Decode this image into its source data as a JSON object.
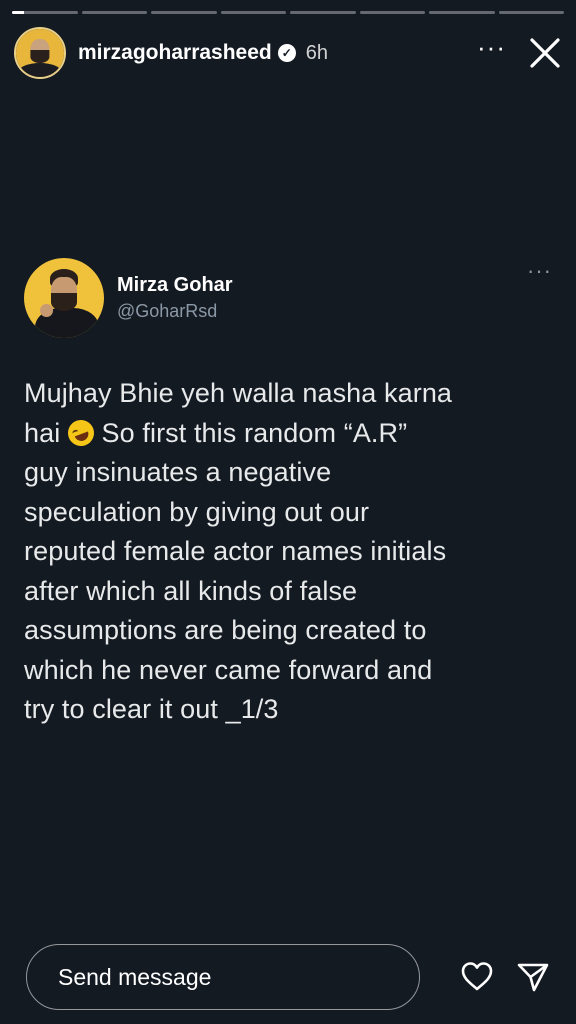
{
  "story": {
    "progress": {
      "segments": 8,
      "active_index": 0,
      "active_fill": 0.18
    },
    "header": {
      "username": "mirzagoharrasheed",
      "verified_icon": "verified-badge-icon",
      "time": "6h",
      "more_icon": "more-horizontal-icon",
      "close_icon": "close-icon"
    }
  },
  "tweet": {
    "display_name": "Mirza Gohar",
    "handle": "@GoharRsd",
    "more_icon": "more-horizontal-icon",
    "text_before_emoji": "Mujhay Bhie yeh walla nasha karna\nhai ",
    "emoji": "rolling-on-floor-laughing-emoji",
    "text_after_emoji": " So first this random “A.R”\nguy insinuates a negative\nspeculation by giving out our\nreputed female actor names initials\nafter which all kinds of false\nassumptions are being created to\nwhich he never came forward and\ntry to clear it out _1/3"
  },
  "footer": {
    "message_placeholder": "Send message",
    "heart_icon": "heart-icon",
    "share_icon": "send-icon"
  },
  "colors": {
    "background": "#141a22",
    "text": "#ffffff",
    "handle": "#8b98a5",
    "avatar_ring": "#e9d08a"
  }
}
